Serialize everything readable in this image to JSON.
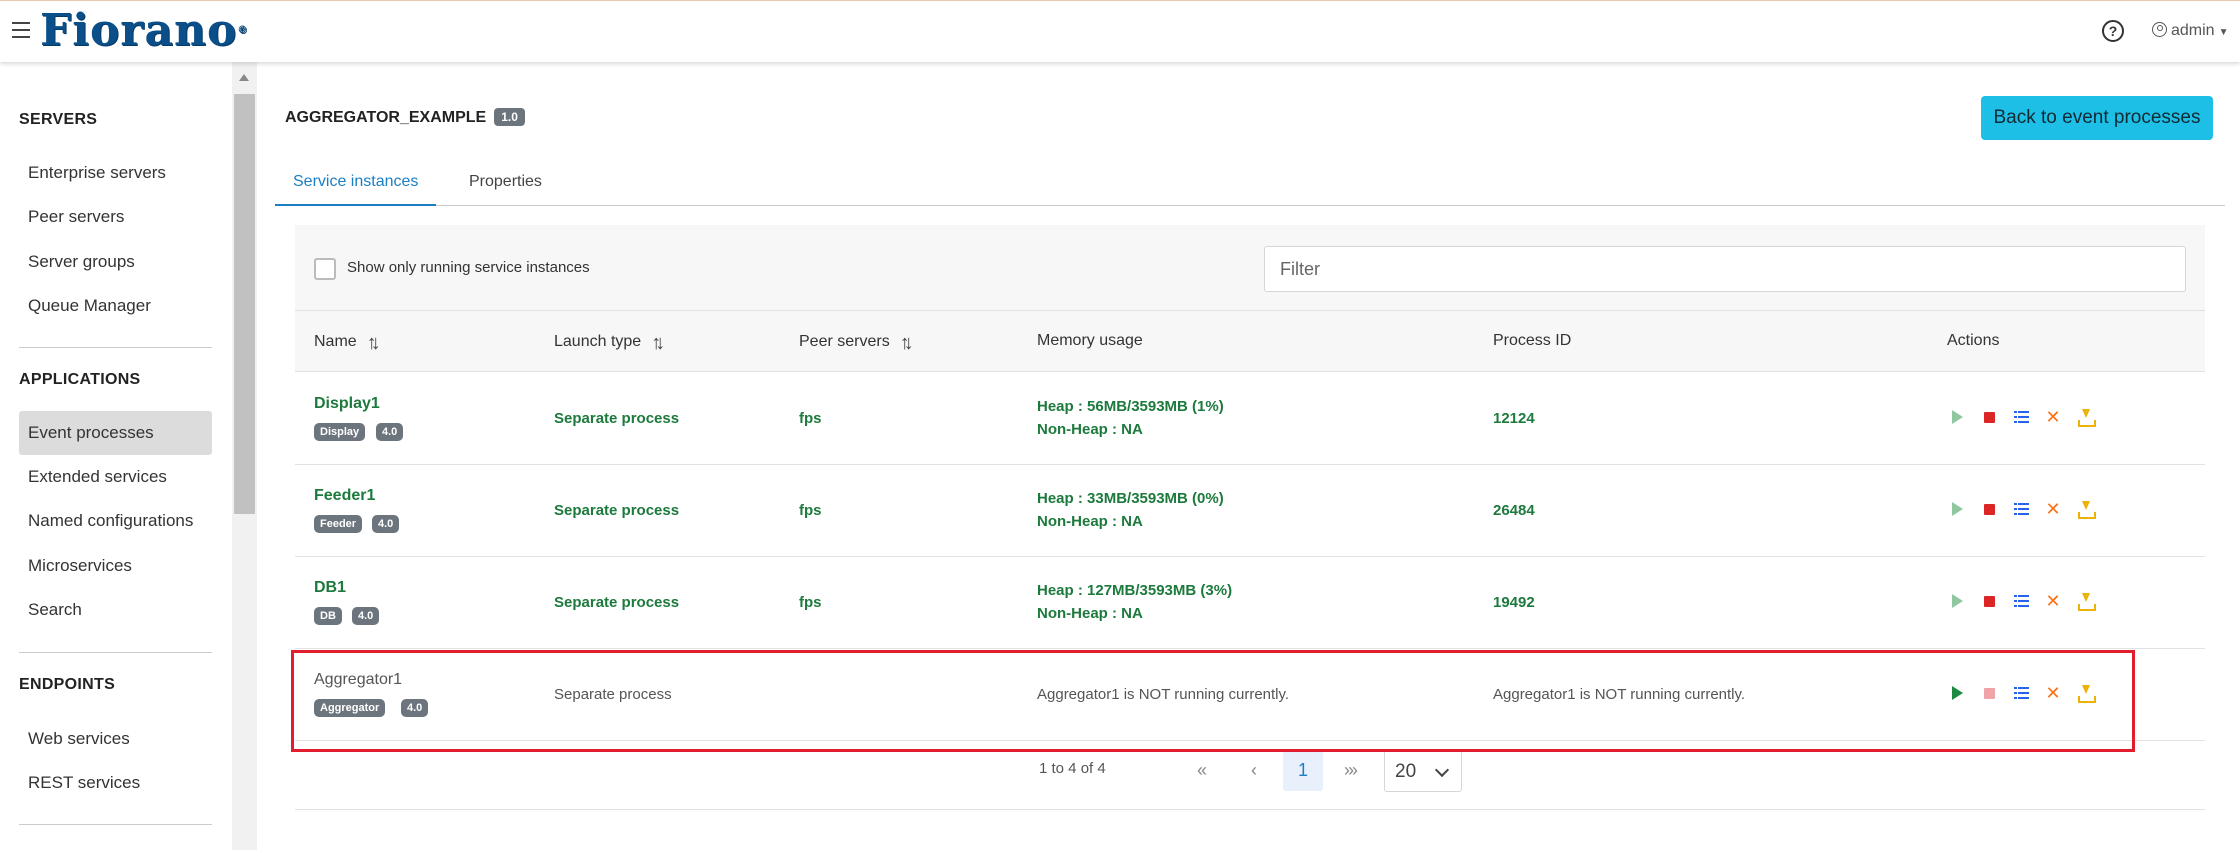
{
  "header": {
    "logo": "Fiorano",
    "logo_mark": "®",
    "user": "admin"
  },
  "sidebar": {
    "sections": [
      {
        "title": "SERVERS",
        "items": [
          "Enterprise servers",
          "Peer servers",
          "Server groups",
          "Queue Manager"
        ]
      },
      {
        "title": "APPLICATIONS",
        "items": [
          "Event processes",
          "Extended services",
          "Named configurations",
          "Microservices",
          "Search"
        ]
      },
      {
        "title": "ENDPOINTS",
        "items": [
          "Web services",
          "REST services"
        ]
      }
    ],
    "active_item": "Event processes"
  },
  "main": {
    "title": "AGGREGATOR_EXAMPLE",
    "version": "1.0",
    "back_button": "Back to event processes",
    "tabs": [
      "Service instances",
      "Properties"
    ],
    "active_tab": "Service instances",
    "show_running_label": "Show only running service instances",
    "filter_placeholder": "Filter",
    "columns": [
      "Name",
      "Launch type",
      "Peer servers",
      "Memory usage",
      "Process ID",
      "Actions"
    ],
    "rows": [
      {
        "name": "Display1",
        "tag": "Display",
        "version": "4.0",
        "launch": "Separate process",
        "peer": "fps",
        "heap": "Heap : 56MB/3593MB (1%)",
        "nonheap": "Non-Heap : NA",
        "pid": "12124",
        "running": true
      },
      {
        "name": "Feeder1",
        "tag": "Feeder",
        "version": "4.0",
        "launch": "Separate process",
        "peer": "fps",
        "heap": "Heap : 33MB/3593MB (0%)",
        "nonheap": "Non-Heap : NA",
        "pid": "26484",
        "running": true
      },
      {
        "name": "DB1",
        "tag": "DB",
        "version": "4.0",
        "launch": "Separate process",
        "peer": "fps",
        "heap": "Heap : 127MB/3593MB (3%)",
        "nonheap": "Non-Heap : NA",
        "pid": "19492",
        "running": true
      },
      {
        "name": "Aggregator1",
        "tag": "Aggregator",
        "version": "4.0",
        "launch": "Separate process",
        "peer": "",
        "memory_msg": "Aggregator1 is NOT running currently.",
        "pid_msg": "Aggregator1 is NOT running currently.",
        "running": false
      }
    ],
    "pagination": {
      "summary": "1 to 4 of 4",
      "first": "«",
      "prev": "‹",
      "current": "1",
      "next": "›",
      "last": "»",
      "page_size": "20"
    }
  }
}
